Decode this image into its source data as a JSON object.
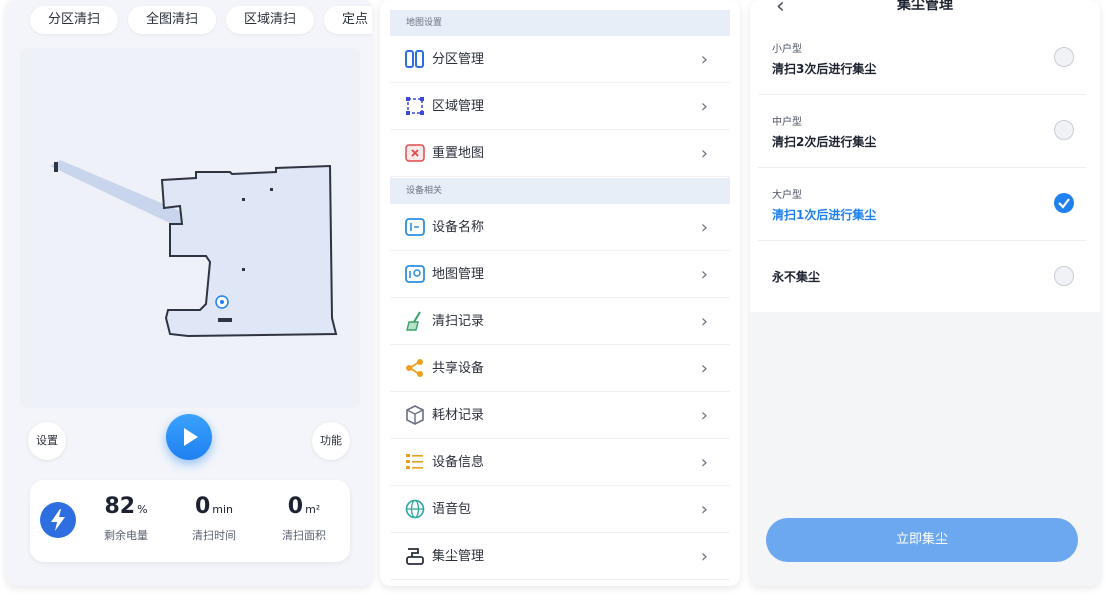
{
  "map_screen": {
    "chips": [
      "分区清扫",
      "全图清扫",
      "区域清扫",
      "定点"
    ],
    "settings_label": "设置",
    "function_label": "功能",
    "stats": {
      "battery": {
        "value": "82",
        "unit": "%",
        "label": "剩余电量"
      },
      "time": {
        "value": "0",
        "unit": "min",
        "label": "清扫时间"
      },
      "area": {
        "value": "0",
        "unit": "m²",
        "label": "清扫面积"
      }
    }
  },
  "settings_list": {
    "sections": [
      {
        "header": "地图设置",
        "items": [
          {
            "label": "分区管理",
            "icon": "partition-icon",
            "color": "#2d6fe0"
          },
          {
            "label": "区域管理",
            "icon": "area-select-icon",
            "color": "#3a4bd8"
          },
          {
            "label": "重置地图",
            "icon": "reset-map-icon",
            "color": "#e24a4a"
          }
        ]
      },
      {
        "header": "设备相关",
        "items": [
          {
            "label": "设备名称",
            "icon": "device-name-icon",
            "color": "#2d8fe0"
          },
          {
            "label": "地图管理",
            "icon": "map-manage-icon",
            "color": "#2d8fe0"
          },
          {
            "label": "清扫记录",
            "icon": "broom-icon",
            "color": "#3aa06a"
          },
          {
            "label": "共享设备",
            "icon": "share-icon",
            "color": "#f0a020"
          },
          {
            "label": "耗材记录",
            "icon": "consumable-icon",
            "color": "#6a7080"
          },
          {
            "label": "设备信息",
            "icon": "device-info-icon",
            "color": "#e8a020"
          },
          {
            "label": "语音包",
            "icon": "voice-globe-icon",
            "color": "#2aa8a0"
          },
          {
            "label": "集尘管理",
            "icon": "dust-manage-icon",
            "color": "#2a2f3a"
          }
        ]
      }
    ],
    "chevron": "›"
  },
  "dust_screen": {
    "title": "集尘管理",
    "options": [
      {
        "title": "小户型",
        "desc": "清扫3次后进行集尘",
        "selected": false
      },
      {
        "title": "中户型",
        "desc": "清扫2次后进行集尘",
        "selected": false
      },
      {
        "title": "大户型",
        "desc": "清扫1次后进行集尘",
        "selected": true
      },
      {
        "title": "",
        "desc": "永不集尘",
        "selected": false
      }
    ],
    "action_button": "立即集尘"
  },
  "colors": {
    "accent": "#1f80f0",
    "section_bg": "#e8eef8"
  }
}
